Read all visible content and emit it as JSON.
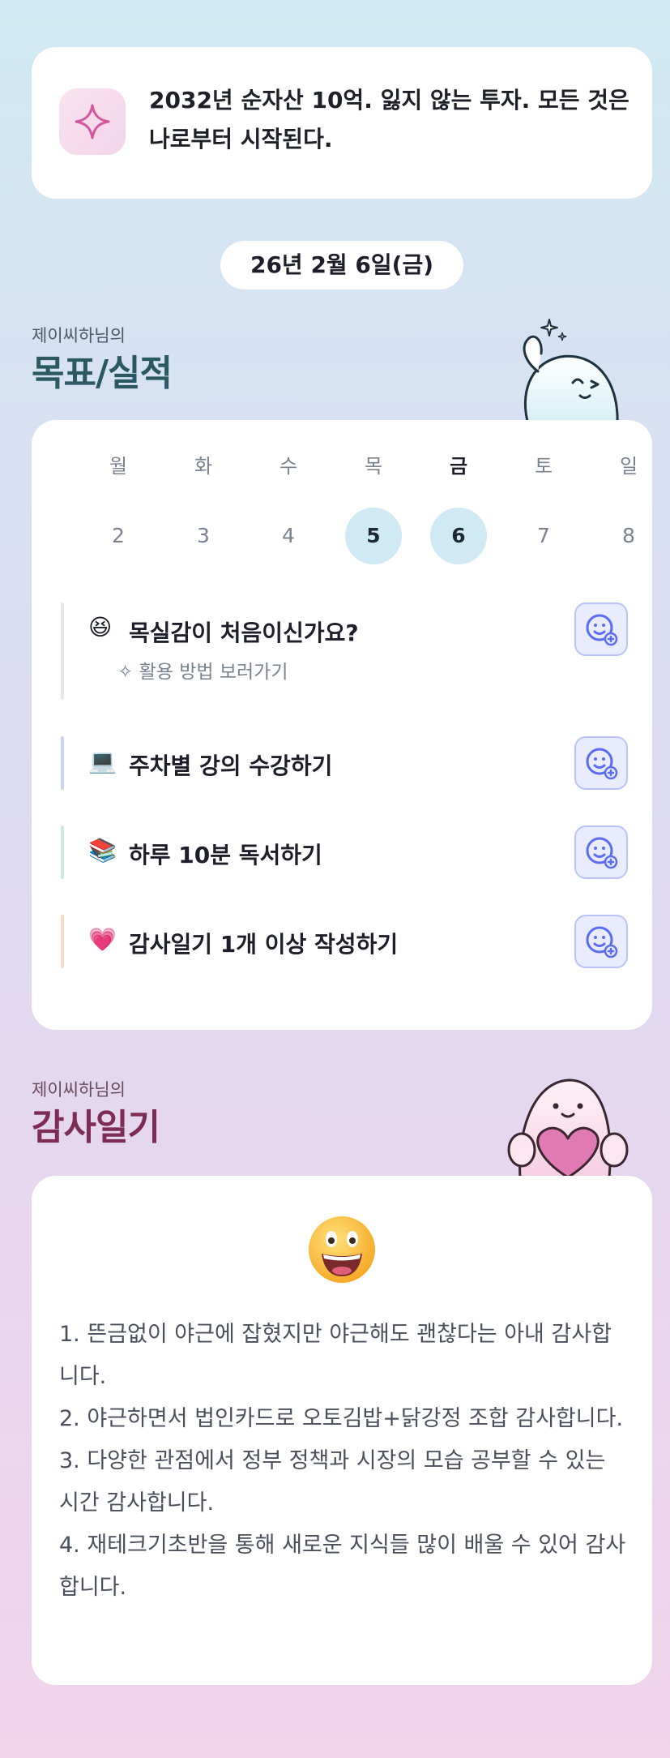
{
  "motto": {
    "icon": "sparkle-icon",
    "text": "2032년 순자산 10억. 잃지 않는 투자. 모든 것은 나로부터 시작된다."
  },
  "date_label": "26년 2월 6일(금)",
  "goals_section": {
    "subtitle": "제이씨하님의",
    "title": "목표/실적"
  },
  "week": {
    "days": [
      {
        "name": "월",
        "num": "2"
      },
      {
        "name": "화",
        "num": "3"
      },
      {
        "name": "수",
        "num": "4"
      },
      {
        "name": "목",
        "num": "5"
      },
      {
        "name": "금",
        "num": "6"
      },
      {
        "name": "토",
        "num": "7"
      },
      {
        "name": "일",
        "num": "8"
      }
    ],
    "active_day": "금"
  },
  "tasks": [
    {
      "emoji": "😆",
      "label": "목실감이 처음이신가요?",
      "bar_color": "#e6e8ec",
      "sub": "활용 방법 보러가기"
    },
    {
      "emoji": "💻",
      "label": "주차별 강의 수강하기",
      "bar_color": "#c9d3f6"
    },
    {
      "emoji": "📚",
      "label": "하루 10분 독서하기",
      "bar_color": "#c8eadf"
    },
    {
      "emoji": "💗",
      "label": "감사일기 1개 이상 작성하기",
      "bar_color": "#f6dcc2"
    }
  ],
  "thanks_section": {
    "subtitle": "제이씨하님의",
    "title": "감사일기",
    "lines": [
      "1. 뜬금없이 야근에 잡혔지만 야근해도 괜찮다는 아내 감사합니다.",
      "2. 야근하면서 법인카드로 오토김밥+닭강정 조합 감사합니다.",
      "3. 다양한 관점에서 정부 정책과 시장의 모습 공부할 수 있는 시간 감사합니다.",
      "4. 재테크기초반을 통해 새로운 지식들 많이 배울 수 있어 감사합니다."
    ]
  },
  "colors": {
    "accent_teal": "#2b5963",
    "accent_plum": "#7c2c55",
    "check_bg": "#e8ecfe",
    "check_border": "#b9c3fb"
  }
}
